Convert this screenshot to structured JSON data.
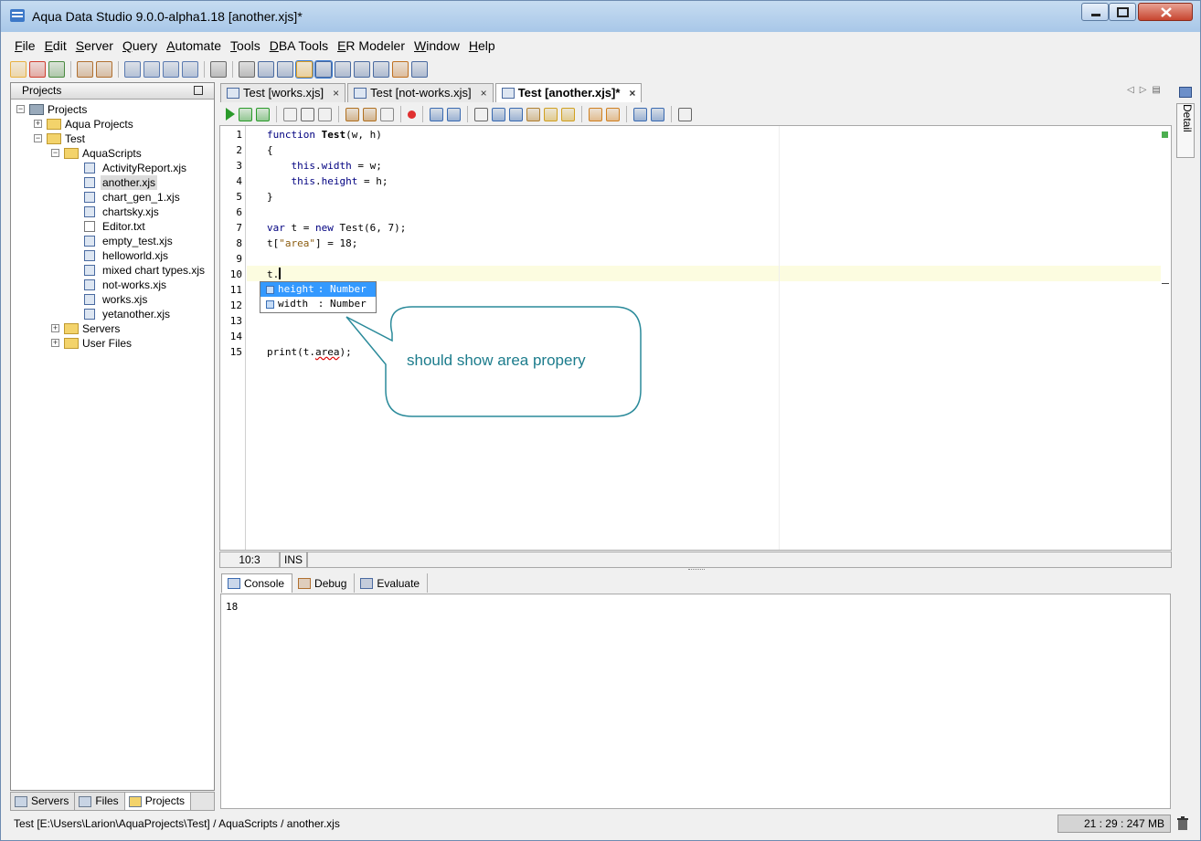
{
  "window": {
    "title": "Aqua Data Studio 9.0.0-alpha1.18 [another.xjs]*"
  },
  "menu": [
    {
      "label": "File",
      "underline": "F",
      "rest": "ile"
    },
    {
      "label": "Edit",
      "underline": "E",
      "rest": "dit"
    },
    {
      "label": "Server",
      "underline": "S",
      "rest": "erver"
    },
    {
      "label": "Query",
      "underline": "Q",
      "rest": "uery"
    },
    {
      "label": "Automate",
      "underline": "A",
      "rest": "utomate"
    },
    {
      "label": "Tools",
      "underline": "T",
      "rest": "ools"
    },
    {
      "label": "DBA Tools",
      "underline": "D",
      "rest": "BA Tools"
    },
    {
      "label": "ER Modeler",
      "underline": "E",
      "rest": "R Modeler"
    },
    {
      "label": "Window",
      "underline": "W",
      "rest": "indow"
    },
    {
      "label": "Help",
      "underline": "H",
      "rest": "elp"
    }
  ],
  "projects_panel": {
    "header": "Projects",
    "tree": [
      {
        "label": "Projects",
        "level": 0,
        "expander": "−",
        "icon": "project-root-icon"
      },
      {
        "label": "Aqua Projects",
        "level": 1,
        "expander": "+",
        "icon": "folder-icon"
      },
      {
        "label": "Test",
        "level": 1,
        "expander": "−",
        "icon": "folder-open-icon"
      },
      {
        "label": "AquaScripts",
        "level": 2,
        "expander": "−",
        "icon": "folder-open-icon"
      },
      {
        "label": "ActivityReport.xjs",
        "level": 3,
        "icon": "script-file-icon"
      },
      {
        "label": "another.xjs",
        "level": 3,
        "icon": "script-file-icon",
        "selected": true
      },
      {
        "label": "chart_gen_1.xjs",
        "level": 3,
        "icon": "script-file-icon"
      },
      {
        "label": "chartsky.xjs",
        "level": 3,
        "icon": "script-file-icon"
      },
      {
        "label": "Editor.txt",
        "level": 3,
        "icon": "text-file-icon"
      },
      {
        "label": "empty_test.xjs",
        "level": 3,
        "icon": "script-file-icon"
      },
      {
        "label": "helloworld.xjs",
        "level": 3,
        "icon": "script-file-icon"
      },
      {
        "label": "mixed chart types.xjs",
        "level": 3,
        "icon": "script-file-icon"
      },
      {
        "label": "not-works.xjs",
        "level": 3,
        "icon": "script-file-icon"
      },
      {
        "label": "works.xjs",
        "level": 3,
        "icon": "script-file-icon"
      },
      {
        "label": "yetanother.xjs",
        "level": 3,
        "icon": "script-file-icon"
      },
      {
        "label": "Servers",
        "level": 2,
        "expander": "+",
        "icon": "folder-icon"
      },
      {
        "label": "User Files",
        "level": 2,
        "expander": "+",
        "icon": "folder-icon"
      }
    ],
    "bottom_tabs": [
      {
        "label": "Servers",
        "icon": "servers-icon"
      },
      {
        "label": "Files",
        "icon": "files-icon"
      },
      {
        "label": "Projects",
        "icon": "projects-icon",
        "active": true
      }
    ]
  },
  "editor_tabs": [
    {
      "label": "Test [works.xjs]",
      "close": "×"
    },
    {
      "label": "Test [not-works.xjs]",
      "close": "×"
    },
    {
      "label": "Test [another.xjs]*",
      "close": "×",
      "active": true
    }
  ],
  "detail_label": "Detail",
  "code": {
    "line_numbers": [
      "1",
      "2",
      "3",
      "4",
      "5",
      "6",
      "7",
      "8",
      "9",
      "10",
      "11",
      "12",
      "13",
      "14",
      "15"
    ],
    "lines": [
      {
        "n": 1,
        "parts": [
          {
            "t": "function ",
            "c": "kw"
          },
          {
            "t": "Test",
            "c": "fn"
          },
          {
            "t": "(w, h)",
            "c": ""
          }
        ]
      },
      {
        "n": 2,
        "parts": [
          {
            "t": "{",
            "c": ""
          }
        ]
      },
      {
        "n": 3,
        "parts": [
          {
            "t": "    ",
            "c": ""
          },
          {
            "t": "this",
            "c": "kw"
          },
          {
            "t": ".",
            "c": ""
          },
          {
            "t": "width",
            "c": "prop"
          },
          {
            "t": " = w;",
            "c": ""
          }
        ]
      },
      {
        "n": 4,
        "parts": [
          {
            "t": "    ",
            "c": ""
          },
          {
            "t": "this",
            "c": "kw"
          },
          {
            "t": ".",
            "c": ""
          },
          {
            "t": "height",
            "c": "prop"
          },
          {
            "t": " = h;",
            "c": ""
          }
        ]
      },
      {
        "n": 5,
        "parts": [
          {
            "t": "}",
            "c": ""
          }
        ]
      },
      {
        "n": 7,
        "parts": [
          {
            "t": "var",
            "c": "kw"
          },
          {
            "t": " t = ",
            "c": ""
          },
          {
            "t": "new",
            "c": "kw"
          },
          {
            "t": " Test(6, 7);",
            "c": ""
          }
        ]
      },
      {
        "n": 8,
        "parts": [
          {
            "t": "t[",
            "c": ""
          },
          {
            "t": "\"area\"",
            "c": "str"
          },
          {
            "t": "] = 18;",
            "c": ""
          }
        ]
      },
      {
        "n": 10,
        "parts": [
          {
            "t": "t.",
            "c": ""
          }
        ]
      },
      {
        "n": 15,
        "parts": [
          {
            "t": "print(t.",
            "c": ""
          },
          {
            "t": "area",
            "c": "squiggle"
          },
          {
            "t": ");",
            "c": ""
          }
        ]
      }
    ]
  },
  "autocomplete": [
    {
      "name": "height",
      "type": ": Number",
      "selected": true
    },
    {
      "name": "width ",
      "type": ": Number"
    }
  ],
  "callout": "should show area propery",
  "editor_status": {
    "position": "10:3",
    "mode": "INS"
  },
  "console_tabs": [
    {
      "label": "Console",
      "icon": "console-icon",
      "active": true
    },
    {
      "label": "Debug",
      "icon": "debug-icon"
    },
    {
      "label": "Evaluate",
      "icon": "evaluate-icon"
    }
  ],
  "console_output": "18",
  "statusbar": {
    "path": "Test [E:\\Users\\Larion\\AquaProjects\\Test] / AquaScripts / another.xjs",
    "memory": "21 : 29 : 247 MB"
  },
  "colors": {
    "accent": "#3399ff",
    "callout_text": "#1c7c8c",
    "callout_border": "#2a8a9a",
    "keyword": "#000080",
    "string": "#8b5c0f"
  }
}
